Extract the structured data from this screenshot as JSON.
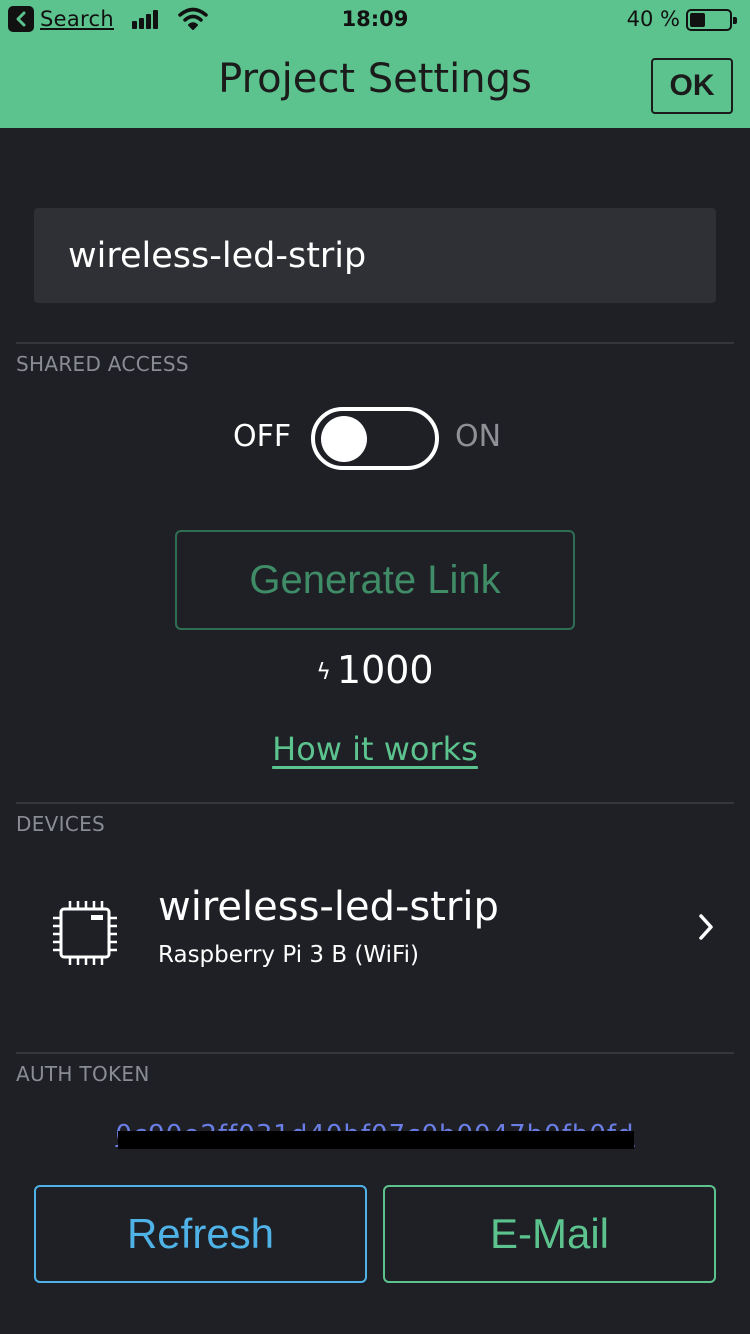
{
  "status_bar": {
    "back_app_label": "Search",
    "time": "18:09",
    "battery_text": "40 %",
    "battery_level": 0.4
  },
  "nav": {
    "title": "Project Settings",
    "ok_label": "OK"
  },
  "project": {
    "name_value": "wireless-led-strip"
  },
  "shared_access": {
    "section_label": "SHARED ACCESS",
    "toggle_off_label": "OFF",
    "toggle_on_label": "ON",
    "toggle_state": "off",
    "generate_link_label": "Generate Link",
    "energy_value": "1000",
    "how_it_works_label": "How it works"
  },
  "devices": {
    "section_label": "DEVICES",
    "items": [
      {
        "name": "wireless-led-strip",
        "type": "Raspberry Pi 3 B (WiFi)"
      }
    ]
  },
  "auth_token": {
    "section_label": "AUTH TOKEN",
    "token_text": "0c90e2ff031d40bf07c0b0047b0fb0fd",
    "redacted": true
  },
  "actions": {
    "refresh_label": "Refresh",
    "email_label": "E-Mail"
  },
  "colors": {
    "accent_green": "#5cc38e",
    "background": "#1e2026",
    "refresh_blue": "#4fb3e8",
    "token_link": "#6a7ee6"
  }
}
